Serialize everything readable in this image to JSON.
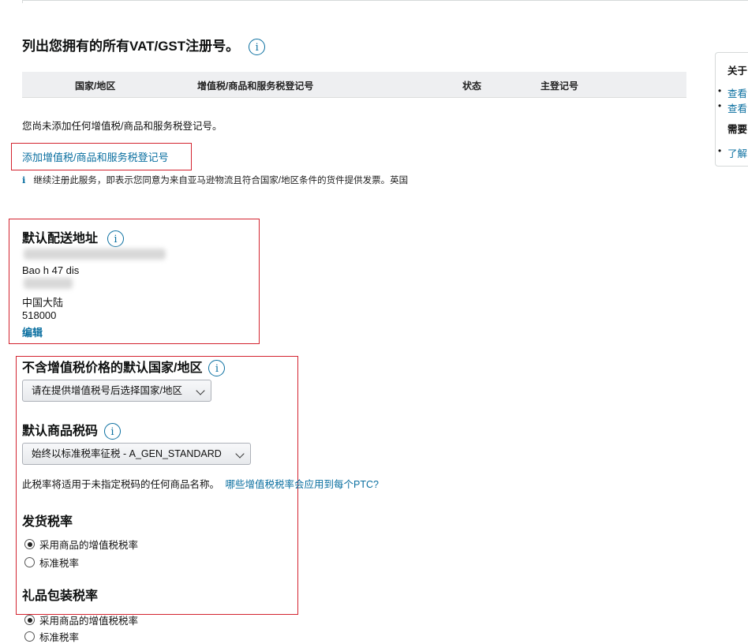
{
  "vat": {
    "heading": "列出您拥有的所有VAT/GST注册号。",
    "table_headers": [
      "国家/地区",
      "增值税/商品和服务税登记号",
      "状态",
      "主登记号"
    ],
    "empty_message": "您尚未添加任何增值税/商品和服务税登记号。",
    "add_link": "添加增值税/商品和服务税登记号",
    "notice_icon": "i",
    "notice": "继续注册此服务，即表示您同意为来自亚马逊物流且符合国家/地区条件的货件提供发票。英国"
  },
  "address": {
    "title": "默认配送地址",
    "lines": [
      "Bao h 47 dis",
      "中国大陆",
      "518000"
    ],
    "edit_link": "编辑"
  },
  "tax_defaults": {
    "country_title": "不含增值税价格的默认国家/地区",
    "country_select": "请在提供增值税号后选择国家/地区",
    "ptc_title": "默认商品税码",
    "ptc_select": "始终以标准税率征税 - A_GEN_STANDARD",
    "ptc_note": "此税率将适用于未指定税码的任何商品名称。",
    "ptc_link": "哪些增值税税率会应用到每个PTC?",
    "shipping_title": "发货税率",
    "shipping_options": [
      "采用商品的增值税税率",
      "标准税率"
    ],
    "gift_title": "礼品包装税率",
    "gift_options": [
      "采用商品的增值税税率",
      "标准税率"
    ]
  },
  "info_icon_glyph": "i",
  "sidebar": {
    "title": "关于",
    "links": [
      "查看",
      "查看"
    ],
    "need": "需要",
    "link3": "了解"
  },
  "colors": {
    "link": "#0a6fa0",
    "highlight_border": "#d3232f",
    "header_bg": "#eeeff1"
  },
  "icons": [
    "info-icon",
    "chevron-down-icon",
    "radio-icon"
  ]
}
